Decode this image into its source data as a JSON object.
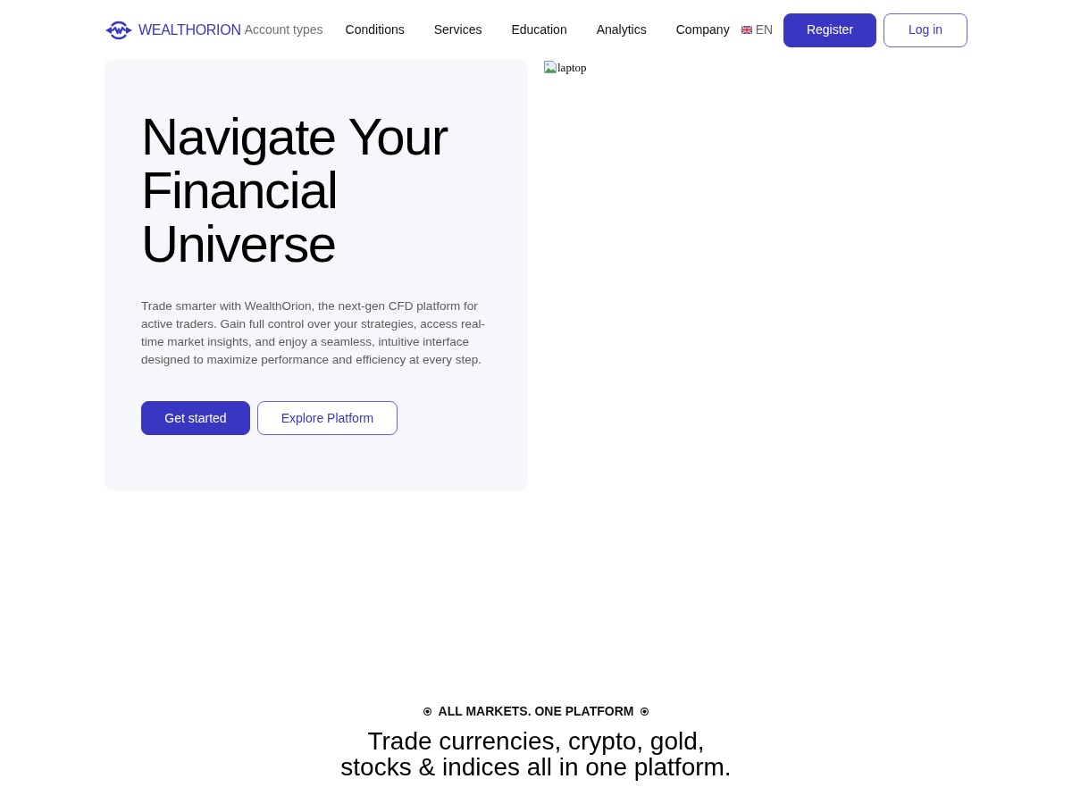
{
  "header": {
    "logo": {
      "text": "WEALTHORION"
    },
    "nav": [
      {
        "label": "Account types",
        "selected": true
      },
      {
        "label": "Conditions",
        "selected": false
      },
      {
        "label": "Services",
        "selected": false
      },
      {
        "label": "Education",
        "selected": false
      },
      {
        "label": "Analytics",
        "selected": false
      },
      {
        "label": "Company",
        "selected": false
      }
    ],
    "language": {
      "code": "EN"
    },
    "buttons": [
      {
        "label": "Register",
        "kind": "primary"
      },
      {
        "label": "Log in",
        "kind": "outline"
      }
    ]
  },
  "hero": {
    "heading": "Navigate Your Financial Universe",
    "description": "Trade smarter with WealthOrion, the next-gen CFD platform for active traders. Gain full control over your strategies, access real-time market insights, and enjoy a seamless, intuitive interface designed to maximize performance and efficiency at every step.",
    "buttons": [
      {
        "label": "Get started",
        "kind": "primary"
      },
      {
        "label": "Explore Platform",
        "kind": "outline"
      }
    ],
    "image": {
      "alt": "laptop"
    }
  },
  "markets": {
    "eyebrow": "ALL MARKETS. ONE PLATFORM",
    "heading": "Trade currencies, crypto, gold, stocks & indices all in one platform."
  }
}
